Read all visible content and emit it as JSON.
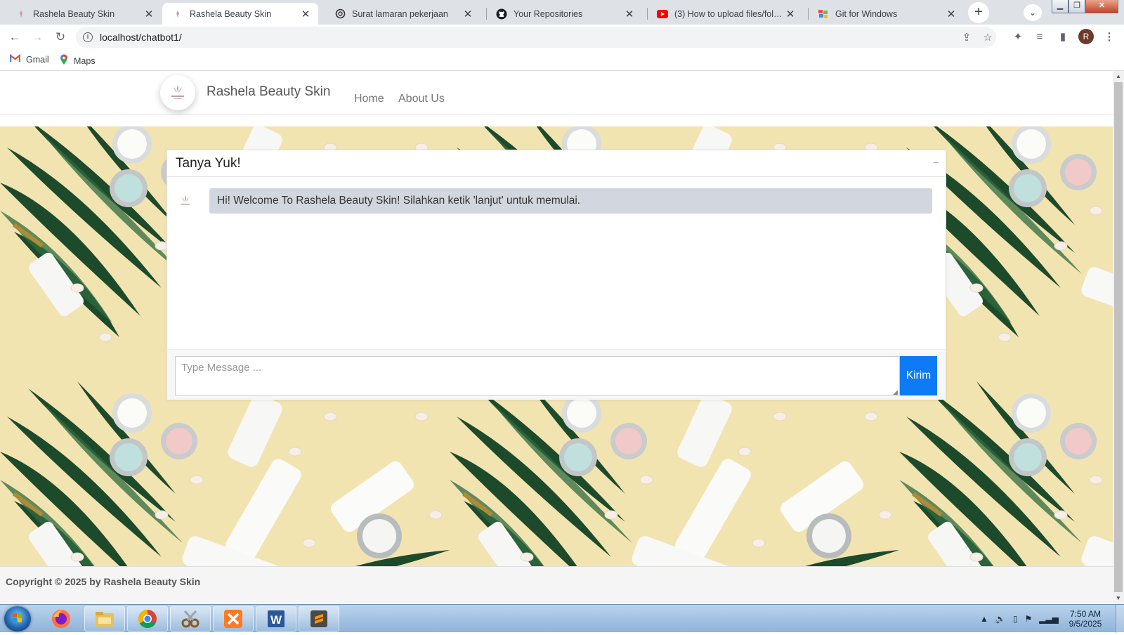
{
  "browser": {
    "tabs": [
      {
        "title": "Rashela Beauty Skin",
        "icon": "rashela-favicon",
        "active": false
      },
      {
        "title": "Rashela Beauty Skin",
        "icon": "rashela-favicon",
        "active": true
      },
      {
        "title": "Surat lamaran pekerjaan",
        "icon": "openai-icon",
        "active": false
      },
      {
        "title": "Your Repositories",
        "icon": "github-icon",
        "active": false
      },
      {
        "title": "(3) How to upload files/folders",
        "icon": "youtube-icon",
        "active": false
      },
      {
        "title": "Git for Windows",
        "icon": "git-icon",
        "active": false
      }
    ],
    "new_tab_label": "+",
    "address": "localhost/chatbot1/",
    "profile_initial": "R",
    "bookmarks": [
      {
        "label": "Gmail",
        "icon": "gmail-icon"
      },
      {
        "label": "Maps",
        "icon": "maps-icon"
      }
    ]
  },
  "site": {
    "brand": "Rashela Beauty Skin",
    "nav": [
      "Home",
      "About Us"
    ],
    "footer": "Copyright © 2025 by Rashela Beauty Skin"
  },
  "chat": {
    "title": "Tanya Yuk!",
    "minimize_label": "–",
    "messages": [
      {
        "from": "bot",
        "text": "Hi! Welcome To Rashela Beauty Skin! Silahkan ketik 'lanjut' untuk memulai."
      }
    ],
    "input_placeholder": "Type Message ...",
    "send_label": "Kirim"
  },
  "taskbar": {
    "apps": [
      "firefox-icon",
      "file-explorer-icon",
      "chrome-icon",
      "snipping-tool-icon",
      "xampp-icon",
      "word-icon",
      "sublime-text-icon"
    ],
    "time": "7:50 AM",
    "date": "9/5/2025"
  },
  "colors": {
    "accent": "#0d7bf5",
    "bot_bubble": "#d2d6de",
    "hero_background": "#f3e5b2"
  }
}
